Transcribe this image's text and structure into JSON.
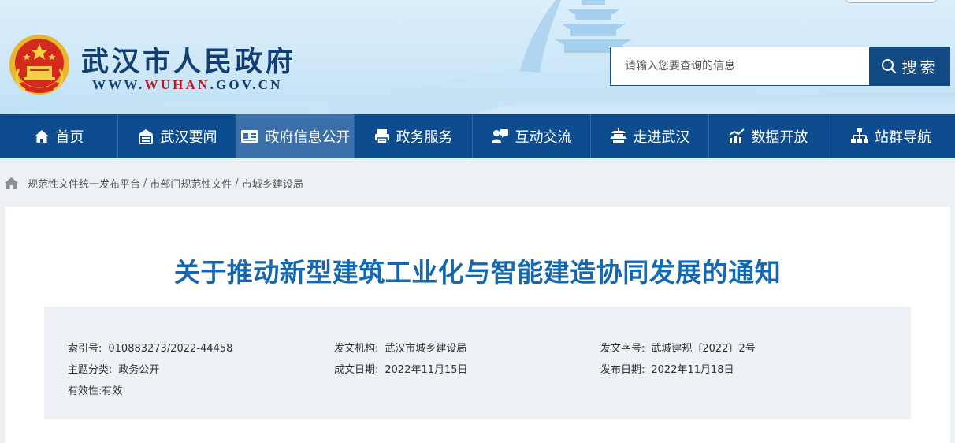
{
  "site": {
    "title": "武汉市人民政府",
    "url_prefix": "WWW.",
    "url_highlight": "WUHAN",
    "url_suffix": ".GOV.CN"
  },
  "search": {
    "placeholder": "请输入您要查询的信息",
    "button_label": "搜索"
  },
  "nav": {
    "items": [
      {
        "label": "首页",
        "icon": "home-icon"
      },
      {
        "label": "武汉要闻",
        "icon": "news-icon"
      },
      {
        "label": "政府信息公开",
        "icon": "info-card-icon"
      },
      {
        "label": "政务服务",
        "icon": "printer-icon"
      },
      {
        "label": "互动交流",
        "icon": "chat-icon"
      },
      {
        "label": "走进武汉",
        "icon": "pavilion-icon"
      },
      {
        "label": "数据开放",
        "icon": "chart-icon"
      },
      {
        "label": "站群导航",
        "icon": "sitemap-icon"
      }
    ],
    "active_index": 2
  },
  "breadcrumb": [
    "规范性文件统一发布平台",
    "市部门规范性文件",
    "市城乡建设局"
  ],
  "article": {
    "title": "关于推动新型建筑工业化与智能建造协同发展的通知",
    "meta": {
      "index_no_label": "索引号:",
      "index_no": "010883273/2022-44458",
      "issuer_label": "发文机构:",
      "issuer": "武汉市城乡建设局",
      "doc_no_label": "发文字号:",
      "doc_no": "武城建规〔2022〕2号",
      "category_label": "主题分类:",
      "category": "政务公开",
      "created_label": "成文日期:",
      "created": "2022年11月15日",
      "published_label": "发布日期:",
      "published": "2022年11月18日",
      "validity_label": "有效性:",
      "validity": "有效"
    }
  },
  "colors": {
    "nav_bg": "#0d4c8f",
    "nav_active": "#3a6fa9",
    "title_blue": "#1567b0",
    "brand_navy": "#123f73",
    "url_red": "#c4161c"
  }
}
